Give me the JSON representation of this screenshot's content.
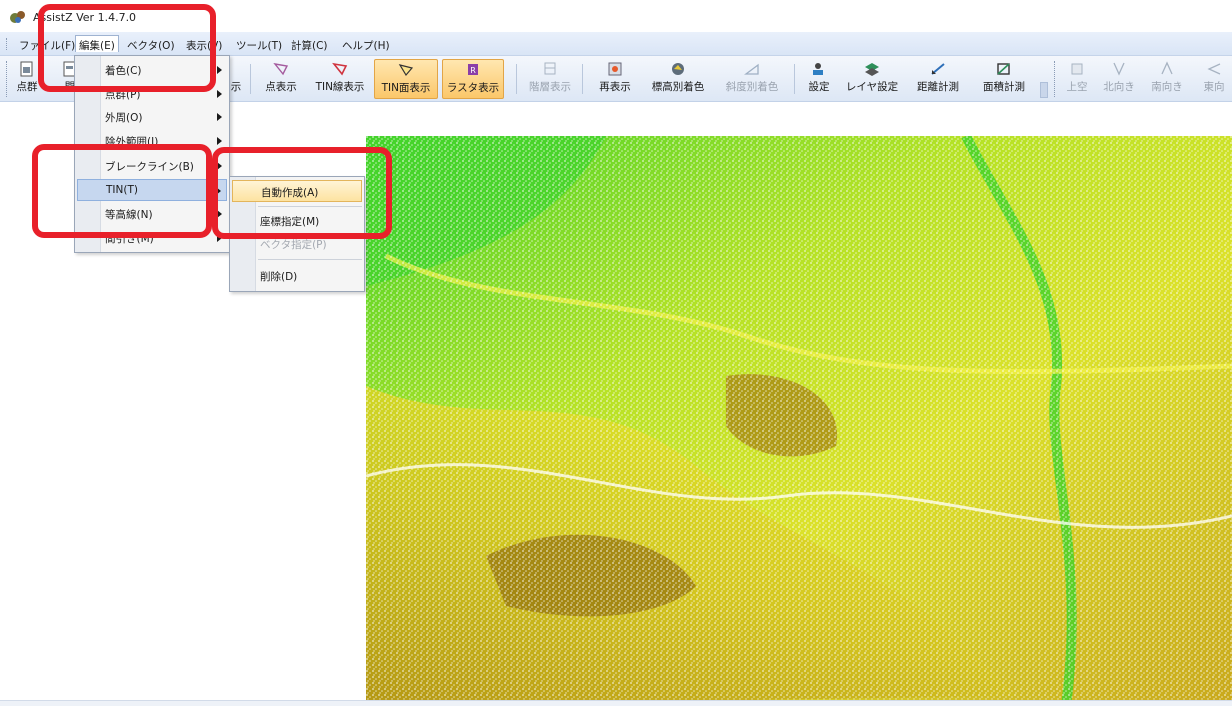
{
  "window": {
    "title": "AssistZ  Ver 1.4.7.0"
  },
  "menubar": {
    "items": [
      {
        "label": "ファイル(F)"
      },
      {
        "label": "編集(E)"
      },
      {
        "label": "ベクタ(O)"
      },
      {
        "label": "表示(V)"
      },
      {
        "label": "ツール(T)"
      },
      {
        "label": "計算(C)"
      },
      {
        "label": "ヘルプ(H)"
      }
    ]
  },
  "toolbar": {
    "items": [
      {
        "label": "点群",
        "icon": "point-cloud-icon"
      },
      {
        "label": "開",
        "icon": "open-icon"
      },
      {
        "label": "示",
        "icon": "show-icon"
      },
      {
        "label": "点表示",
        "icon": "point-display-icon"
      },
      {
        "label": "TIN線表示",
        "icon": "tin-line-icon"
      },
      {
        "label": "TIN面表示",
        "icon": "tin-face-icon",
        "checked": true
      },
      {
        "label": "ラスタ表示",
        "icon": "raster-icon",
        "checked": true
      },
      {
        "label": "階層表示",
        "icon": "layer-icon",
        "disabled": true
      },
      {
        "label": "再表示",
        "icon": "refresh-icon"
      },
      {
        "label": "標高別着色",
        "icon": "elevation-color-icon"
      },
      {
        "label": "斜度別着色",
        "icon": "slope-color-icon",
        "disabled": true
      },
      {
        "label": "設定",
        "icon": "settings-icon"
      },
      {
        "label": "レイヤ設定",
        "icon": "layer-settings-icon"
      },
      {
        "label": "距離計測",
        "icon": "distance-icon"
      },
      {
        "label": "面積計測",
        "icon": "area-icon"
      },
      {
        "label": "上空",
        "icon": "top-view-icon",
        "disabled": true
      },
      {
        "label": "北向き",
        "icon": "north-view-icon",
        "disabled": true
      },
      {
        "label": "南向き",
        "icon": "south-view-icon",
        "disabled": true
      },
      {
        "label": "東向",
        "icon": "east-view-icon",
        "disabled": true
      }
    ]
  },
  "edit_menu": {
    "items": [
      {
        "label": "着色(C)",
        "submenu": true
      },
      {
        "label": "点群(P)",
        "submenu": true
      },
      {
        "label": "外周(O)",
        "submenu": true
      },
      {
        "label": "除外範囲(I)",
        "submenu": true
      },
      {
        "label": "ブレークライン(B)",
        "submenu": true
      },
      {
        "label": "TIN(T)",
        "submenu": true,
        "highlighted": true
      },
      {
        "label": "等高線(N)",
        "submenu": true
      },
      {
        "label": "間引き(M)",
        "submenu": true
      }
    ]
  },
  "tin_submenu": {
    "items": [
      {
        "label": "自動作成(A)",
        "highlighted": true
      },
      {
        "label": "座標指定(M)"
      },
      {
        "label": "ベクタ指定(P)",
        "disabled": true
      },
      {
        "label": "削除(D)"
      }
    ]
  },
  "colors": {
    "annotation": "#e8202a",
    "menu_highlight": "#c6d7ef",
    "toolbar_checked": "#fbc76a",
    "elevation_low": "#b08a10",
    "elevation_mid": "#d8e020",
    "elevation_high": "#3fd22a"
  }
}
